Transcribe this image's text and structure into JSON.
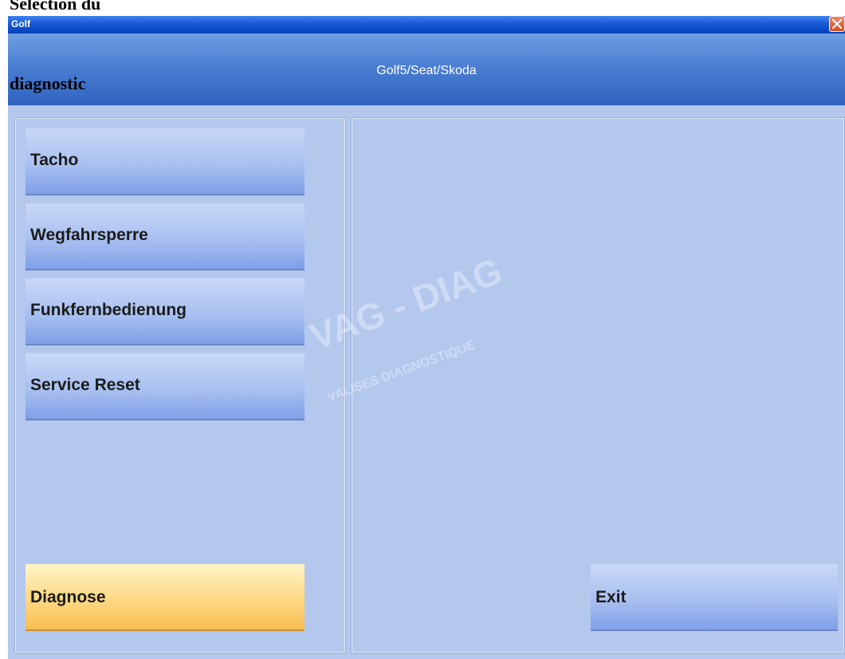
{
  "overlay_caption": {
    "line1": "Selection du",
    "line2": "diagnostic"
  },
  "window": {
    "title": "Golf",
    "close_icon": "close-icon"
  },
  "header": {
    "title": "Golf5/Seat/Skoda"
  },
  "menu": {
    "items": [
      {
        "label": "Tacho"
      },
      {
        "label": "Wegfahrsperre"
      },
      {
        "label": "Funkfernbedienung"
      },
      {
        "label": "Service Reset"
      }
    ],
    "diagnose_label": "Diagnose",
    "exit_label": "Exit"
  },
  "watermark": {
    "main": "VAG - DIAG",
    "sub": "VALISES DIAGNOSTIQUE"
  },
  "colors": {
    "window_bg": "#b4c8ee",
    "header_blue": "#2f62bf",
    "button_blue": "#a9c0f0",
    "diagnose_orange": "#ffd883",
    "close_red": "#d7491f"
  }
}
